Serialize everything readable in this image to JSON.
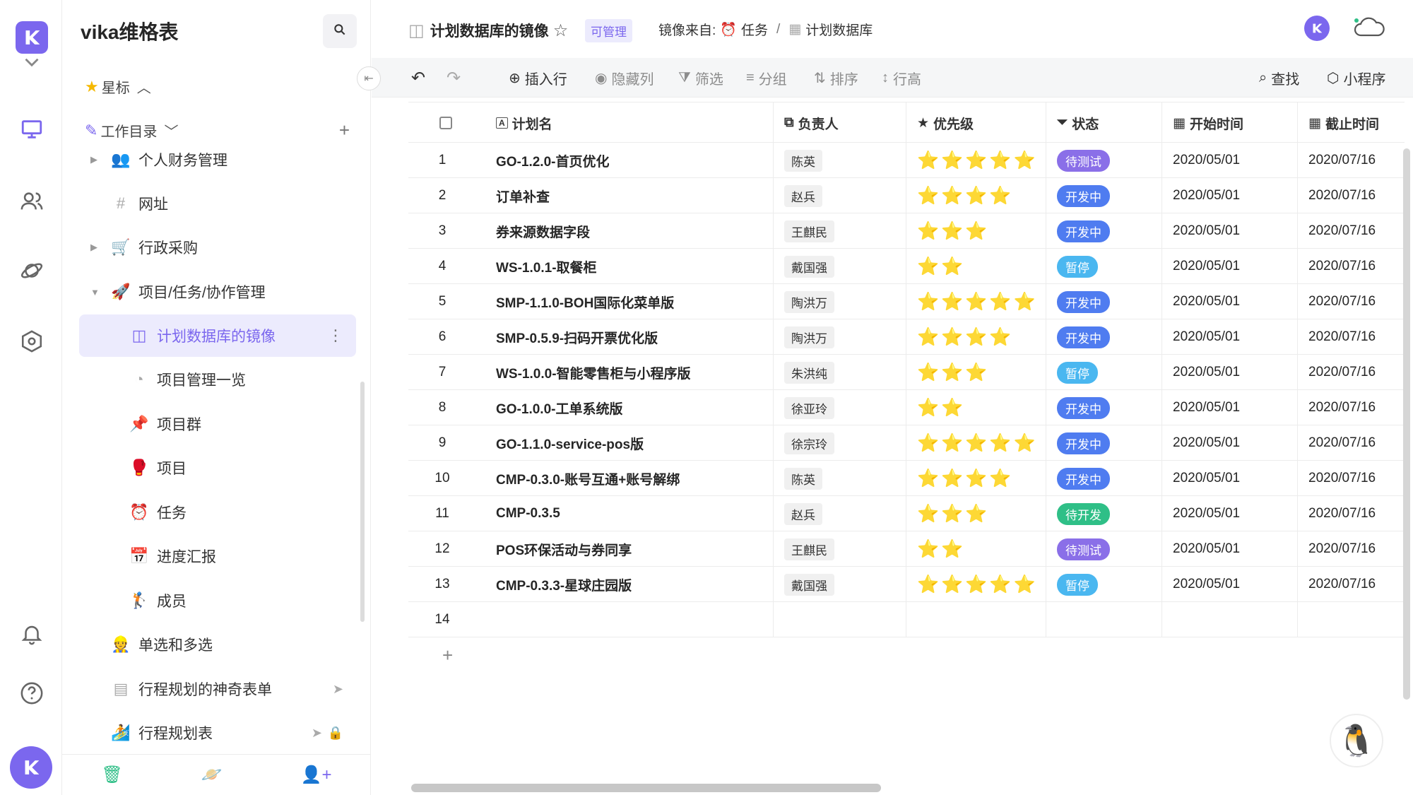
{
  "sidebar": {
    "title": "vika维格表",
    "starred_label": "星标",
    "catalog_label": "工作目录",
    "items": [
      {
        "label": "个人财务管理",
        "icon": "👥"
      },
      {
        "label": "网址",
        "icon": "#"
      },
      {
        "label": "行政采购",
        "icon": "🛒"
      },
      {
        "label": "项目/任务/协作管理",
        "icon": "🚀"
      },
      {
        "label": "计划数据库的镜像",
        "icon": "◫"
      },
      {
        "label": "项目管理一览",
        "icon": "◔"
      },
      {
        "label": "项目群",
        "icon": "📌"
      },
      {
        "label": "项目",
        "icon": "🥊"
      },
      {
        "label": "任务",
        "icon": "⏰"
      },
      {
        "label": "进度汇报",
        "icon": "📅"
      },
      {
        "label": "成员",
        "icon": "🏌"
      },
      {
        "label": "单选和多选",
        "icon": "👷"
      },
      {
        "label": "行程规划的神奇表单",
        "icon": "▤"
      },
      {
        "label": "行程规划表",
        "icon": "🏄"
      }
    ]
  },
  "header": {
    "title": "计划数据库的镜像",
    "permission_badge": "可管理",
    "mirror_from_label": "镜像来自:",
    "mirror_source_task": "任务",
    "mirror_separator": "/",
    "mirror_source_db": "计划数据库"
  },
  "toolbar": {
    "insert_row": "插入行",
    "hide_cols": "隐藏列",
    "filter": "筛选",
    "group": "分组",
    "sort": "排序",
    "row_height": "行高",
    "find": "查找",
    "widget": "小程序"
  },
  "table": {
    "columns": [
      "计划名",
      "负责人",
      "优先级",
      "状态",
      "开始时间",
      "截止时间"
    ],
    "rows": [
      {
        "no": "1",
        "name": "GO-1.2.0-首页优化",
        "owner": "陈英",
        "stars": "⭐⭐⭐⭐⭐",
        "status": "待测试",
        "start": "2020/05/01",
        "end": "2020/07/16"
      },
      {
        "no": "2",
        "name": "订单补查",
        "owner": "赵兵",
        "stars": "⭐⭐⭐⭐",
        "status": "开发中",
        "start": "2020/05/01",
        "end": "2020/07/16"
      },
      {
        "no": "3",
        "name": "券来源数据字段",
        "owner": "王麒民",
        "stars": "⭐⭐⭐",
        "status": "开发中",
        "start": "2020/05/01",
        "end": "2020/07/16"
      },
      {
        "no": "4",
        "name": "WS-1.0.1-取餐柜",
        "owner": "戴国强",
        "stars": "⭐⭐",
        "status": "暂停",
        "start": "2020/05/01",
        "end": "2020/07/16"
      },
      {
        "no": "5",
        "name": "SMP-1.1.0-BOH国际化菜单版",
        "owner": "陶洪万",
        "stars": "⭐⭐⭐⭐⭐",
        "status": "开发中",
        "start": "2020/05/01",
        "end": "2020/07/16"
      },
      {
        "no": "6",
        "name": "SMP-0.5.9-扫码开票优化版",
        "owner": "陶洪万",
        "stars": "⭐⭐⭐⭐",
        "status": "开发中",
        "start": "2020/05/01",
        "end": "2020/07/16"
      },
      {
        "no": "7",
        "name": "WS-1.0.0-智能零售柜与小程序版",
        "owner": "朱洪纯",
        "stars": "⭐⭐⭐",
        "status": "暂停",
        "start": "2020/05/01",
        "end": "2020/07/16"
      },
      {
        "no": "8",
        "name": "GO-1.0.0-工单系统版",
        "owner": "徐亚玲",
        "stars": "⭐⭐",
        "status": "开发中",
        "start": "2020/05/01",
        "end": "2020/07/16"
      },
      {
        "no": "9",
        "name": "GO-1.1.0-service-pos版",
        "owner": "徐宗玲",
        "stars": "⭐⭐⭐⭐⭐",
        "status": "开发中",
        "start": "2020/05/01",
        "end": "2020/07/16"
      },
      {
        "no": "10",
        "name": "CMP-0.3.0-账号互通+账号解绑",
        "owner": "陈英",
        "stars": "⭐⭐⭐⭐",
        "status": "开发中",
        "start": "2020/05/01",
        "end": "2020/07/16"
      },
      {
        "no": "11",
        "name": "CMP-0.3.5",
        "owner": "赵兵",
        "stars": "⭐⭐⭐",
        "status": "待开发",
        "start": "2020/05/01",
        "end": "2020/07/16"
      },
      {
        "no": "12",
        "name": "POS环保活动与券同享",
        "owner": "王麒民",
        "stars": "⭐⭐",
        "status": "待测试",
        "start": "2020/05/01",
        "end": "2020/07/16"
      },
      {
        "no": "13",
        "name": "CMP-0.3.3-星球庄园版",
        "owner": "戴国强",
        "stars": "⭐⭐⭐⭐⭐",
        "status": "暂停",
        "start": "2020/05/01",
        "end": "2020/07/16"
      },
      {
        "no": "14",
        "name": "",
        "owner": "",
        "stars": "",
        "status": "",
        "start": "",
        "end": ""
      }
    ],
    "add_row_symbol": "+"
  },
  "colors": {
    "accent": "#7b67ee",
    "status_待测试": "#8a6fe8",
    "status_开发中": "#4f7cf0",
    "status_暂停": "#4ab7f0",
    "status_待开发": "#2fbf87"
  }
}
